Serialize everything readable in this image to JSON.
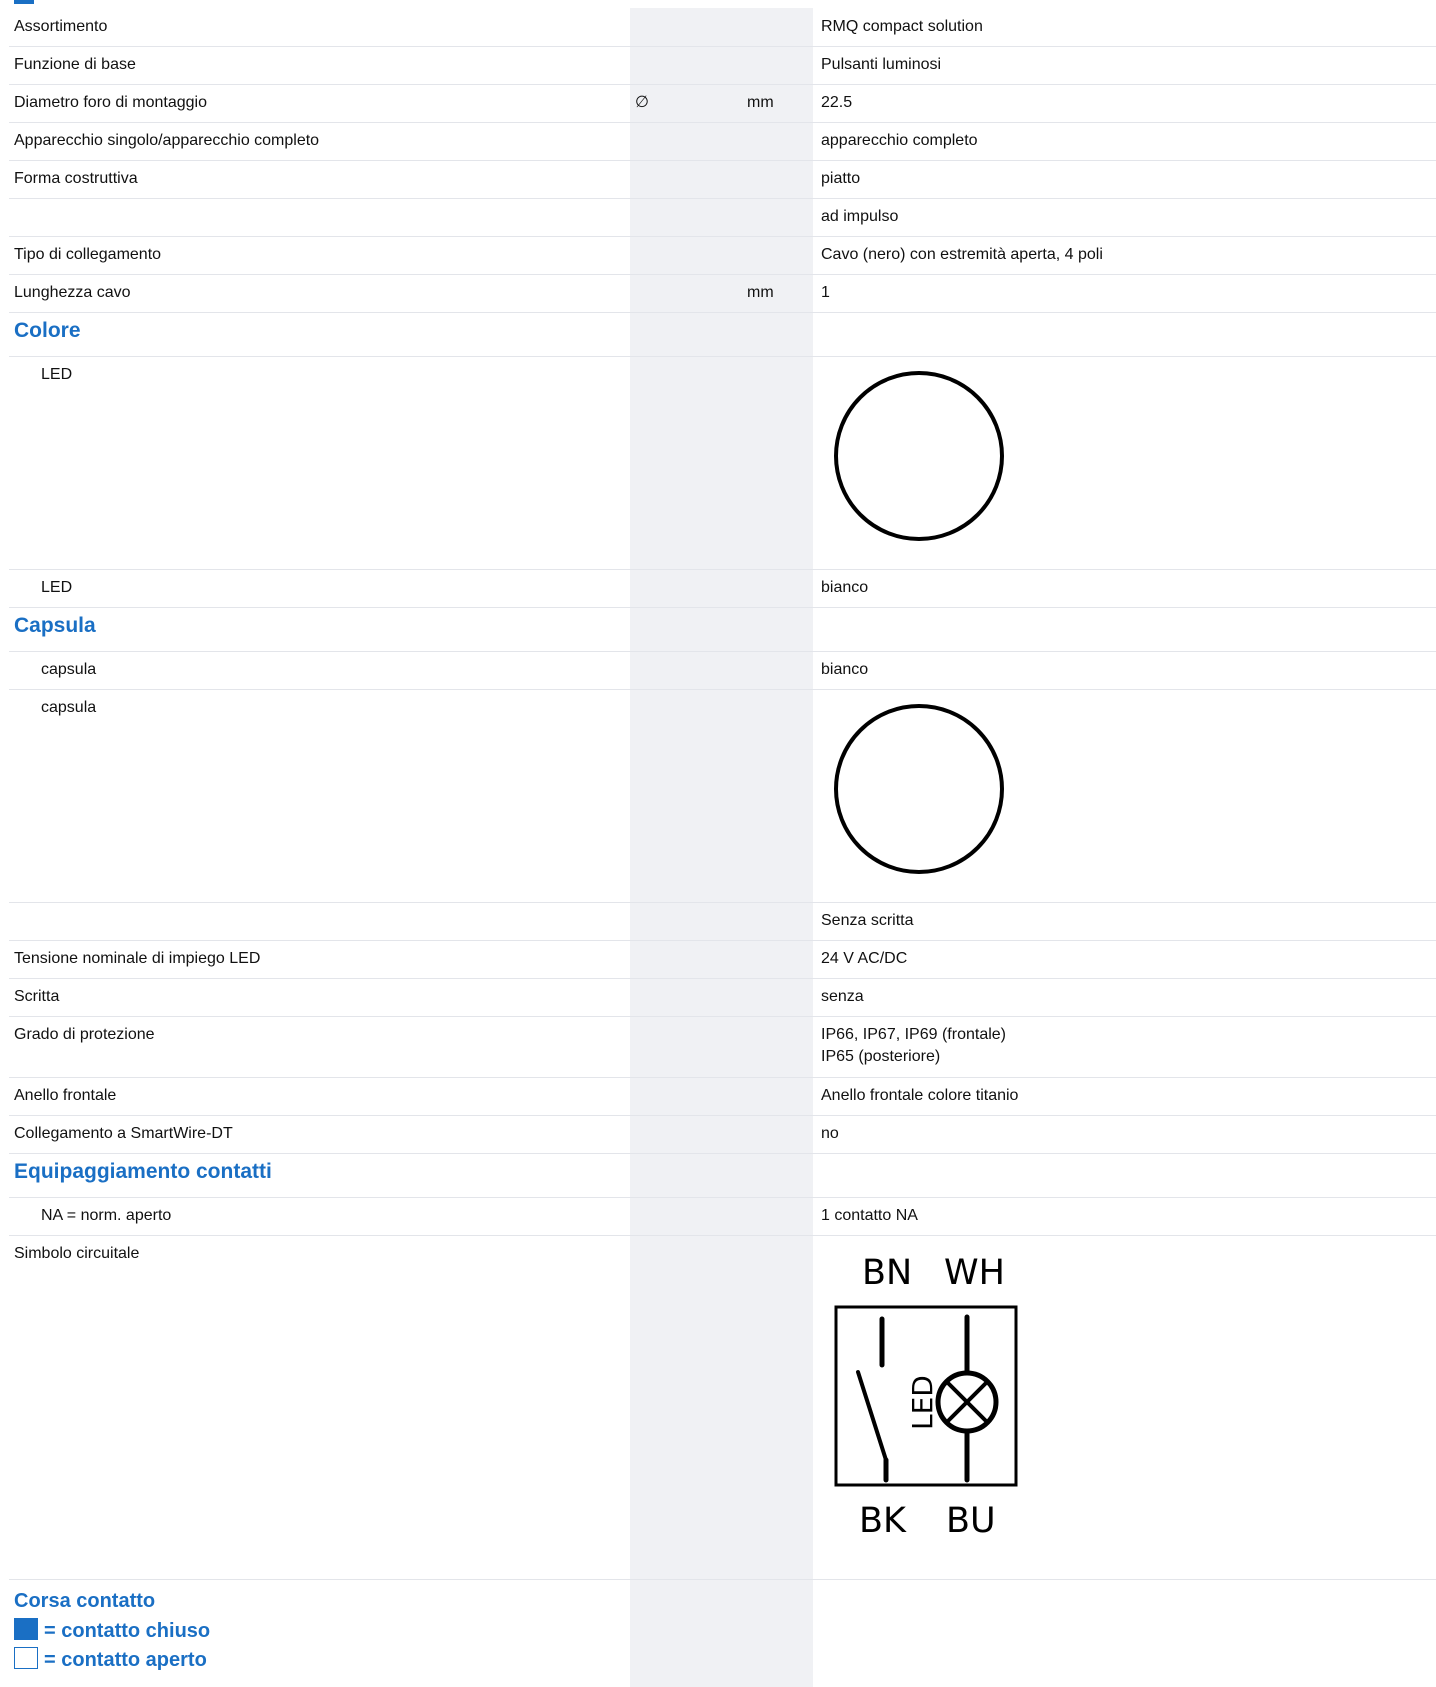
{
  "rows": [
    {
      "label": "Assortimento",
      "symbol": "",
      "unit": "",
      "value": "RMQ compact solution"
    },
    {
      "label": "Funzione di base",
      "symbol": "",
      "unit": "",
      "value": "Pulsanti luminosi"
    },
    {
      "label": "Diametro foro di montaggio",
      "symbol": "∅",
      "unit": "mm",
      "value": "22.5"
    },
    {
      "label": "Apparecchio singolo/apparecchio completo",
      "symbol": "",
      "unit": "",
      "value": "apparecchio completo"
    },
    {
      "label": "Forma costruttiva",
      "symbol": "",
      "unit": "",
      "value": "piatto"
    },
    {
      "label": "",
      "symbol": "",
      "unit": "",
      "value": "ad impulso"
    },
    {
      "label": "Tipo di collegamento",
      "symbol": "",
      "unit": "",
      "value": "Cavo (nero) con estremità aperta, 4 poli"
    },
    {
      "label": "Lunghezza cavo",
      "symbol": "",
      "unit": "mm",
      "value": "1"
    }
  ],
  "colore": {
    "heading": "Colore",
    "led_image_label": "LED",
    "led_label": "LED",
    "led_value": "bianco"
  },
  "capsula": {
    "heading": "Capsula",
    "capsula_label": "capsula",
    "capsula_value": "bianco",
    "capsula_image_label": "capsula",
    "inscription_value": "Senza scritta"
  },
  "rows2": [
    {
      "label": "Tensione nominale di impiego LED",
      "value": "24 V AC/DC"
    },
    {
      "label": "Scritta",
      "value": "senza"
    },
    {
      "label": "Grado di protezione",
      "value": "IP66, IP67, IP69 (frontale)",
      "value2": "IP65 (posteriore)"
    },
    {
      "label": "Anello frontale",
      "value": "Anello frontale colore titanio"
    },
    {
      "label": "Collegamento a SmartWire-DT",
      "value": "no"
    }
  ],
  "contatti": {
    "heading": "Equipaggiamento contatti",
    "na_label": "NA = norm. aperto",
    "na_value": "1 contatto NA",
    "symbol_label": "Simbolo circuitale",
    "diagram": {
      "tl": "BN",
      "tr": "WH",
      "bl": "BK",
      "br": "BU",
      "led": "LED"
    }
  },
  "corsa": {
    "heading": "Corsa contatto",
    "closed": "= contatto chiuso",
    "open": "= contatto aperto"
  },
  "colors": {
    "accent": "#1a6fc4",
    "shade": "#f0f1f4"
  }
}
